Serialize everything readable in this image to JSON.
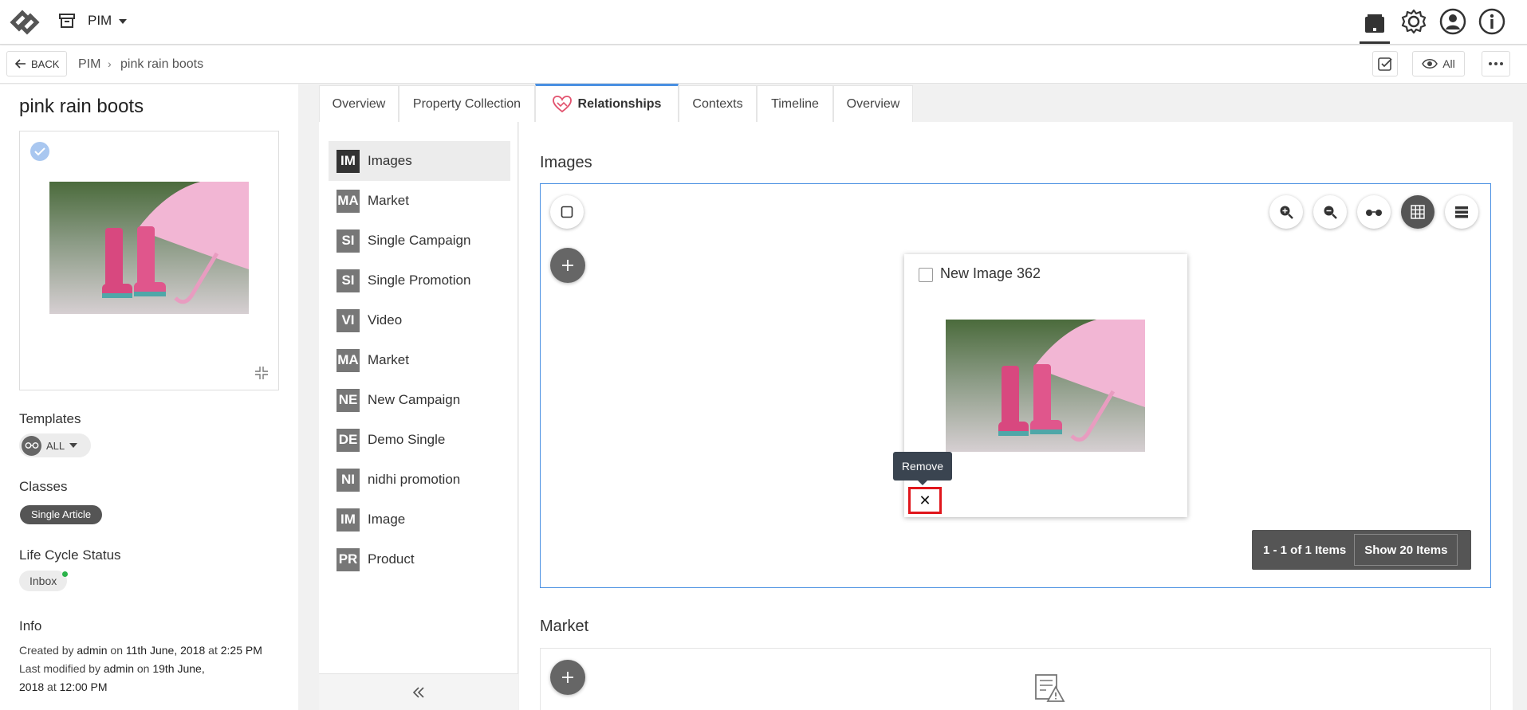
{
  "topbar": {
    "app_name": "PIM",
    "icons": [
      "logo",
      "archive-icon",
      "caret-down-icon",
      "inbox-icon",
      "gear-icon",
      "user-icon",
      "info-icon"
    ]
  },
  "breadcrumb": {
    "back_label": "BACK",
    "items": [
      "PIM",
      "pink rain boots"
    ],
    "view_label": "All"
  },
  "left": {
    "title": "pink rain boots",
    "templates_label": "Templates",
    "templates_value": "ALL",
    "classes_label": "Classes",
    "class_tag": "Single Article",
    "lifecycle_label": "Life Cycle Status",
    "status": "Inbox",
    "status_color": "#2bb34a",
    "info_label": "Info",
    "created_prefix": "Created by",
    "created_by": "admin",
    "created_on_word": "on",
    "created_date": "11th June, 2018",
    "created_at_word": "at",
    "created_time": "2:25 PM",
    "modified_prefix": "Last modified by",
    "modified_by": "admin",
    "modified_on_word": "on",
    "modified_date_a": "19th June,",
    "modified_date_b": "2018",
    "modified_at_word": "at",
    "modified_time": "12:00 PM"
  },
  "tabs": [
    "Overview",
    "Property Collection",
    "Relationships",
    "Contexts",
    "Timeline",
    "Overview"
  ],
  "active_tab": "Relationships",
  "relationships": [
    {
      "abbr": "IM",
      "label": "Images"
    },
    {
      "abbr": "MA",
      "label": "Market"
    },
    {
      "abbr": "SI",
      "label": "Single Campaign"
    },
    {
      "abbr": "SI",
      "label": "Single Promotion"
    },
    {
      "abbr": "VI",
      "label": "Video"
    },
    {
      "abbr": "MA",
      "label": "Market"
    },
    {
      "abbr": "NE",
      "label": "New Campaign"
    },
    {
      "abbr": "DE",
      "label": "Demo Single"
    },
    {
      "abbr": "NI",
      "label": "nidhi promotion"
    },
    {
      "abbr": "IM",
      "label": "Image"
    },
    {
      "abbr": "PR",
      "label": "Product"
    }
  ],
  "content": {
    "images_title": "Images",
    "card_title": "New Image 362",
    "tooltip": "Remove",
    "remove_symbol": "✕",
    "pager_range": "1 - 1 of 1 Items",
    "pager_show": "Show 20 Items",
    "market_title": "Market",
    "accent": "#4a90e2",
    "remove_highlight": "#e0161c"
  }
}
